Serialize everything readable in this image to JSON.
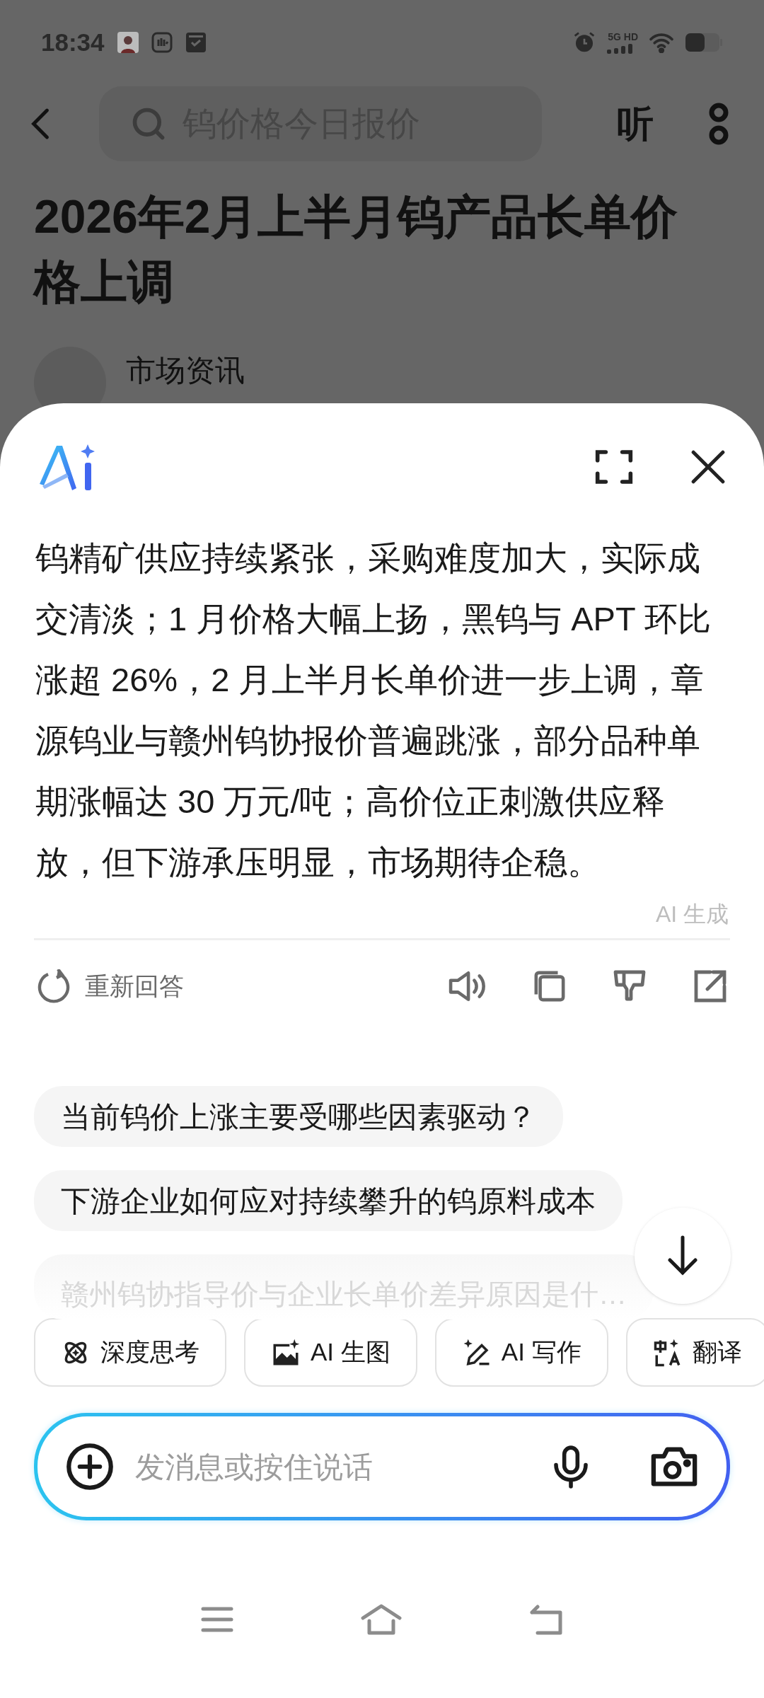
{
  "status_bar": {
    "time": "18:34",
    "network": "5G HD"
  },
  "top_bar": {
    "search": {
      "placeholder": "钨价格今日报价"
    },
    "listen_button": "听"
  },
  "article": {
    "title": "2026年2月上半月钨产品长单价格上调",
    "author": "市场资讯"
  },
  "ai_panel": {
    "answer": "钨精矿供应持续紧张，采购难度加大，实际成交清淡；1 月价格大幅上扬，黑钨与 APT 环比涨超 26%，2 月上半月长单价进一步上调，章源钨业与赣州钨协报价普遍跳涨，部分品种单期涨幅达 30 万元/吨；高价位正刺激供应释放，但下游承压明显，市场期待企稳。",
    "generated_label": "AI 生成",
    "regenerate_button": "重新回答",
    "suggestions": [
      {
        "text": "当前钨价上涨主要受哪些因素驱动？",
        "faded": false
      },
      {
        "text": "下游企业如何应对持续攀升的钨原料成本",
        "faded": false
      },
      {
        "text": "赣州钨协指导价与企业长单价差异原因是什…",
        "faded": true
      }
    ],
    "tools": [
      {
        "kind": "think",
        "label": "深度思考"
      },
      {
        "kind": "image",
        "label": "AI 生图"
      },
      {
        "kind": "write",
        "label": "AI 写作"
      },
      {
        "kind": "translate",
        "label": "翻译"
      }
    ],
    "input": {
      "placeholder": "发消息或按住说话"
    }
  }
}
